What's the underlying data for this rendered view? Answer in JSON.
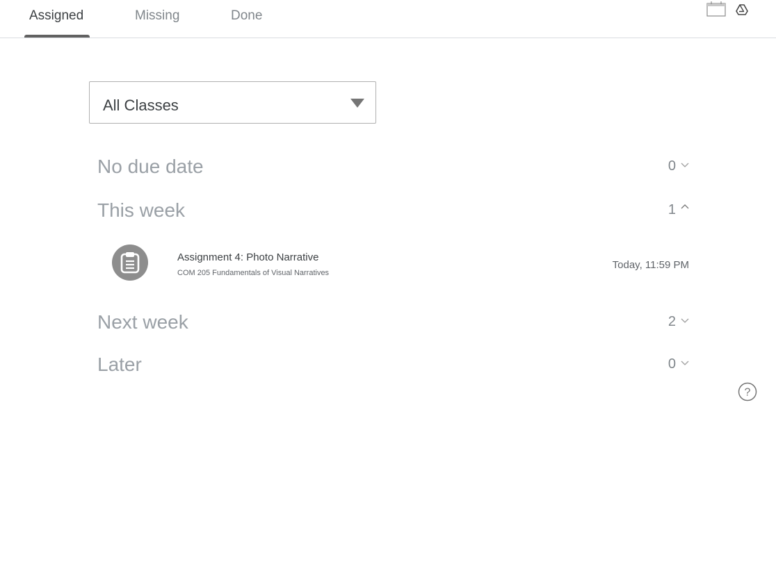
{
  "tabs": [
    {
      "label": "Assigned",
      "active": true
    },
    {
      "label": "Missing",
      "active": false
    },
    {
      "label": "Done",
      "active": false
    }
  ],
  "toolbar_icons": [
    "calendar-icon",
    "google-drive-icon"
  ],
  "class_filter": {
    "selected": "All Classes"
  },
  "sections": [
    {
      "title": "No due date",
      "count": "0",
      "expanded": false
    },
    {
      "title": "This week",
      "count": "1",
      "expanded": true
    },
    {
      "title": "Next week",
      "count": "2",
      "expanded": false
    },
    {
      "title": "Later",
      "count": "0",
      "expanded": false
    }
  ],
  "assignment": {
    "title": "Assignment 4: Photo Narrative",
    "class_name": "COM 205 Fundamentals of Visual Narratives",
    "due": "Today, 11:59 PM",
    "icon": "assignment-icon"
  },
  "help_icon": "help-icon",
  "colors": {
    "tab_indicator": "#616161",
    "section_title": "#9aa0a6",
    "assignment_icon_bg": "#8d8d8d"
  }
}
